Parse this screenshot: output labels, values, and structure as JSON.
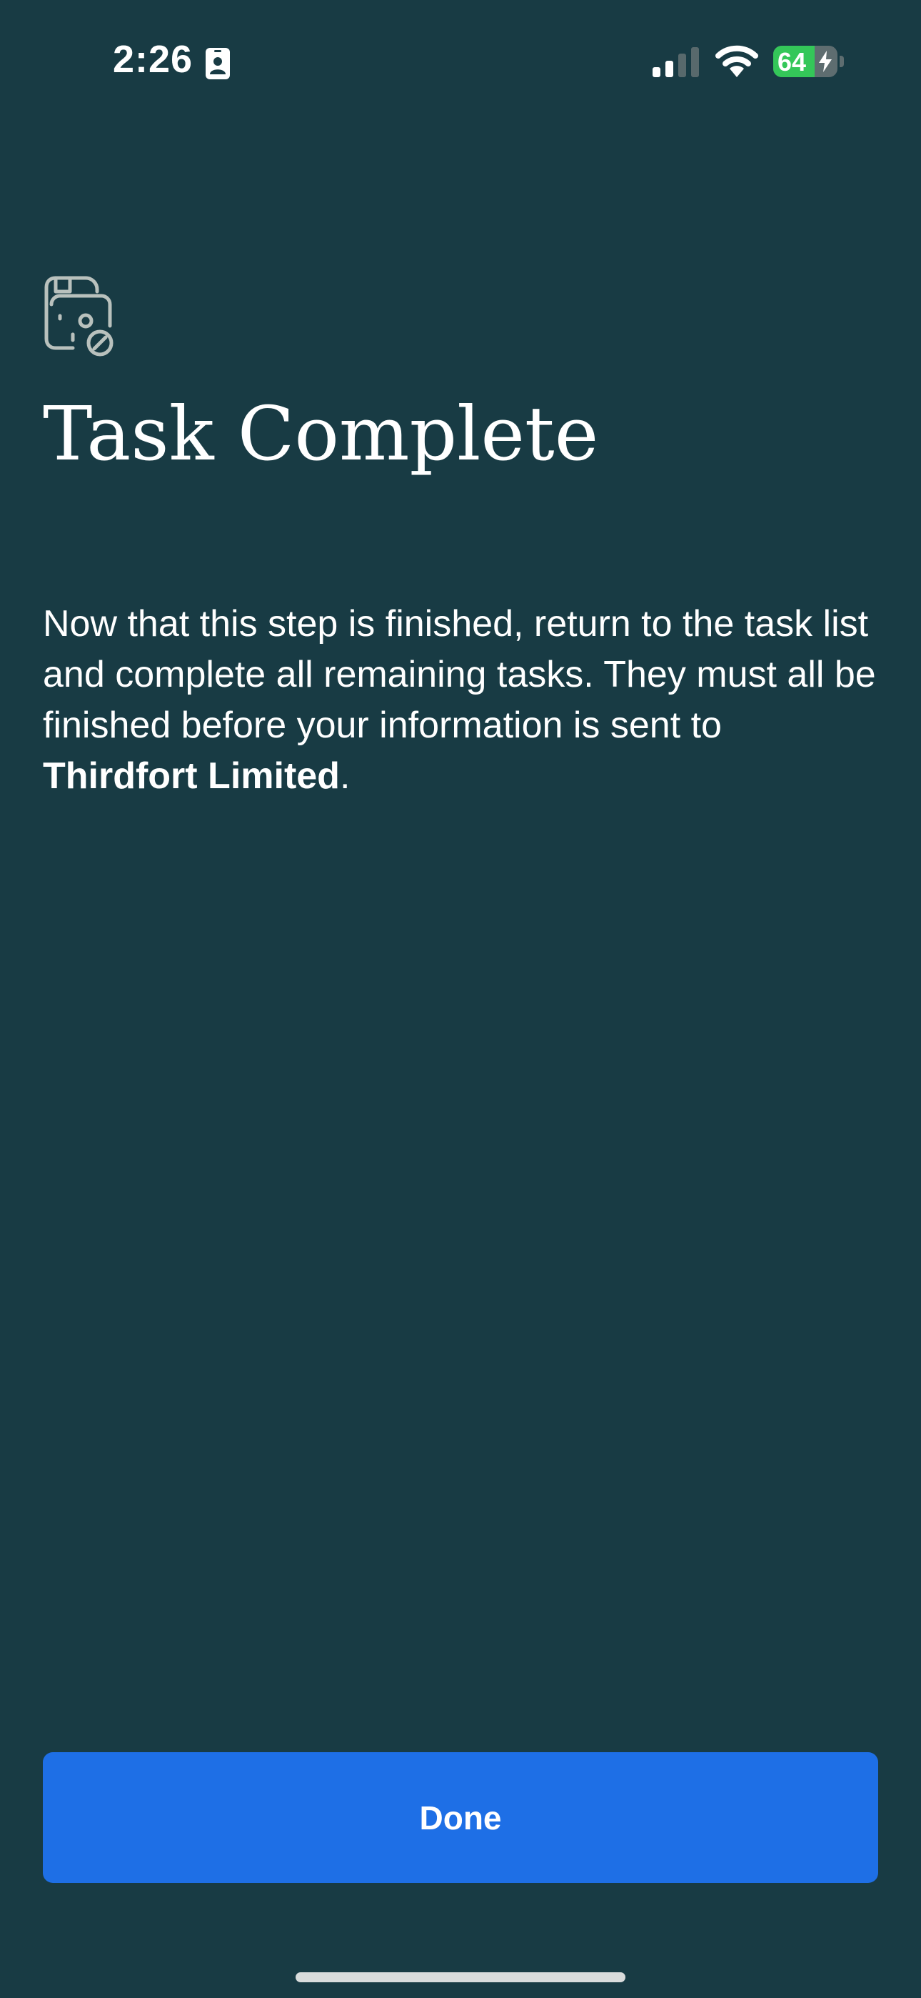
{
  "status_bar": {
    "time": "2:26",
    "battery_percent": "64",
    "battery_level": 0.64,
    "battery_charging": true,
    "signal_bars_active": 2,
    "signal_bars_total": 4,
    "icons": [
      "id-card-icon",
      "signal-icon",
      "wifi-icon",
      "battery-icon",
      "charging-bolt-icon"
    ]
  },
  "header": {
    "icon": "document-photo-icon",
    "title": "Task Complete"
  },
  "body": {
    "message": "Now that this step is finished, return to the task list and complete all remaining tasks. They must all be finished before your information is sent to ",
    "company": "Thirdfort Limited",
    "message_end": "."
  },
  "footer": {
    "done_label": "Done"
  },
  "colors": {
    "background": "#183b44",
    "button": "#1e6fe6",
    "text": "#ffffff",
    "icon": "#b9c1bd",
    "battery_fill": "#34c759"
  }
}
